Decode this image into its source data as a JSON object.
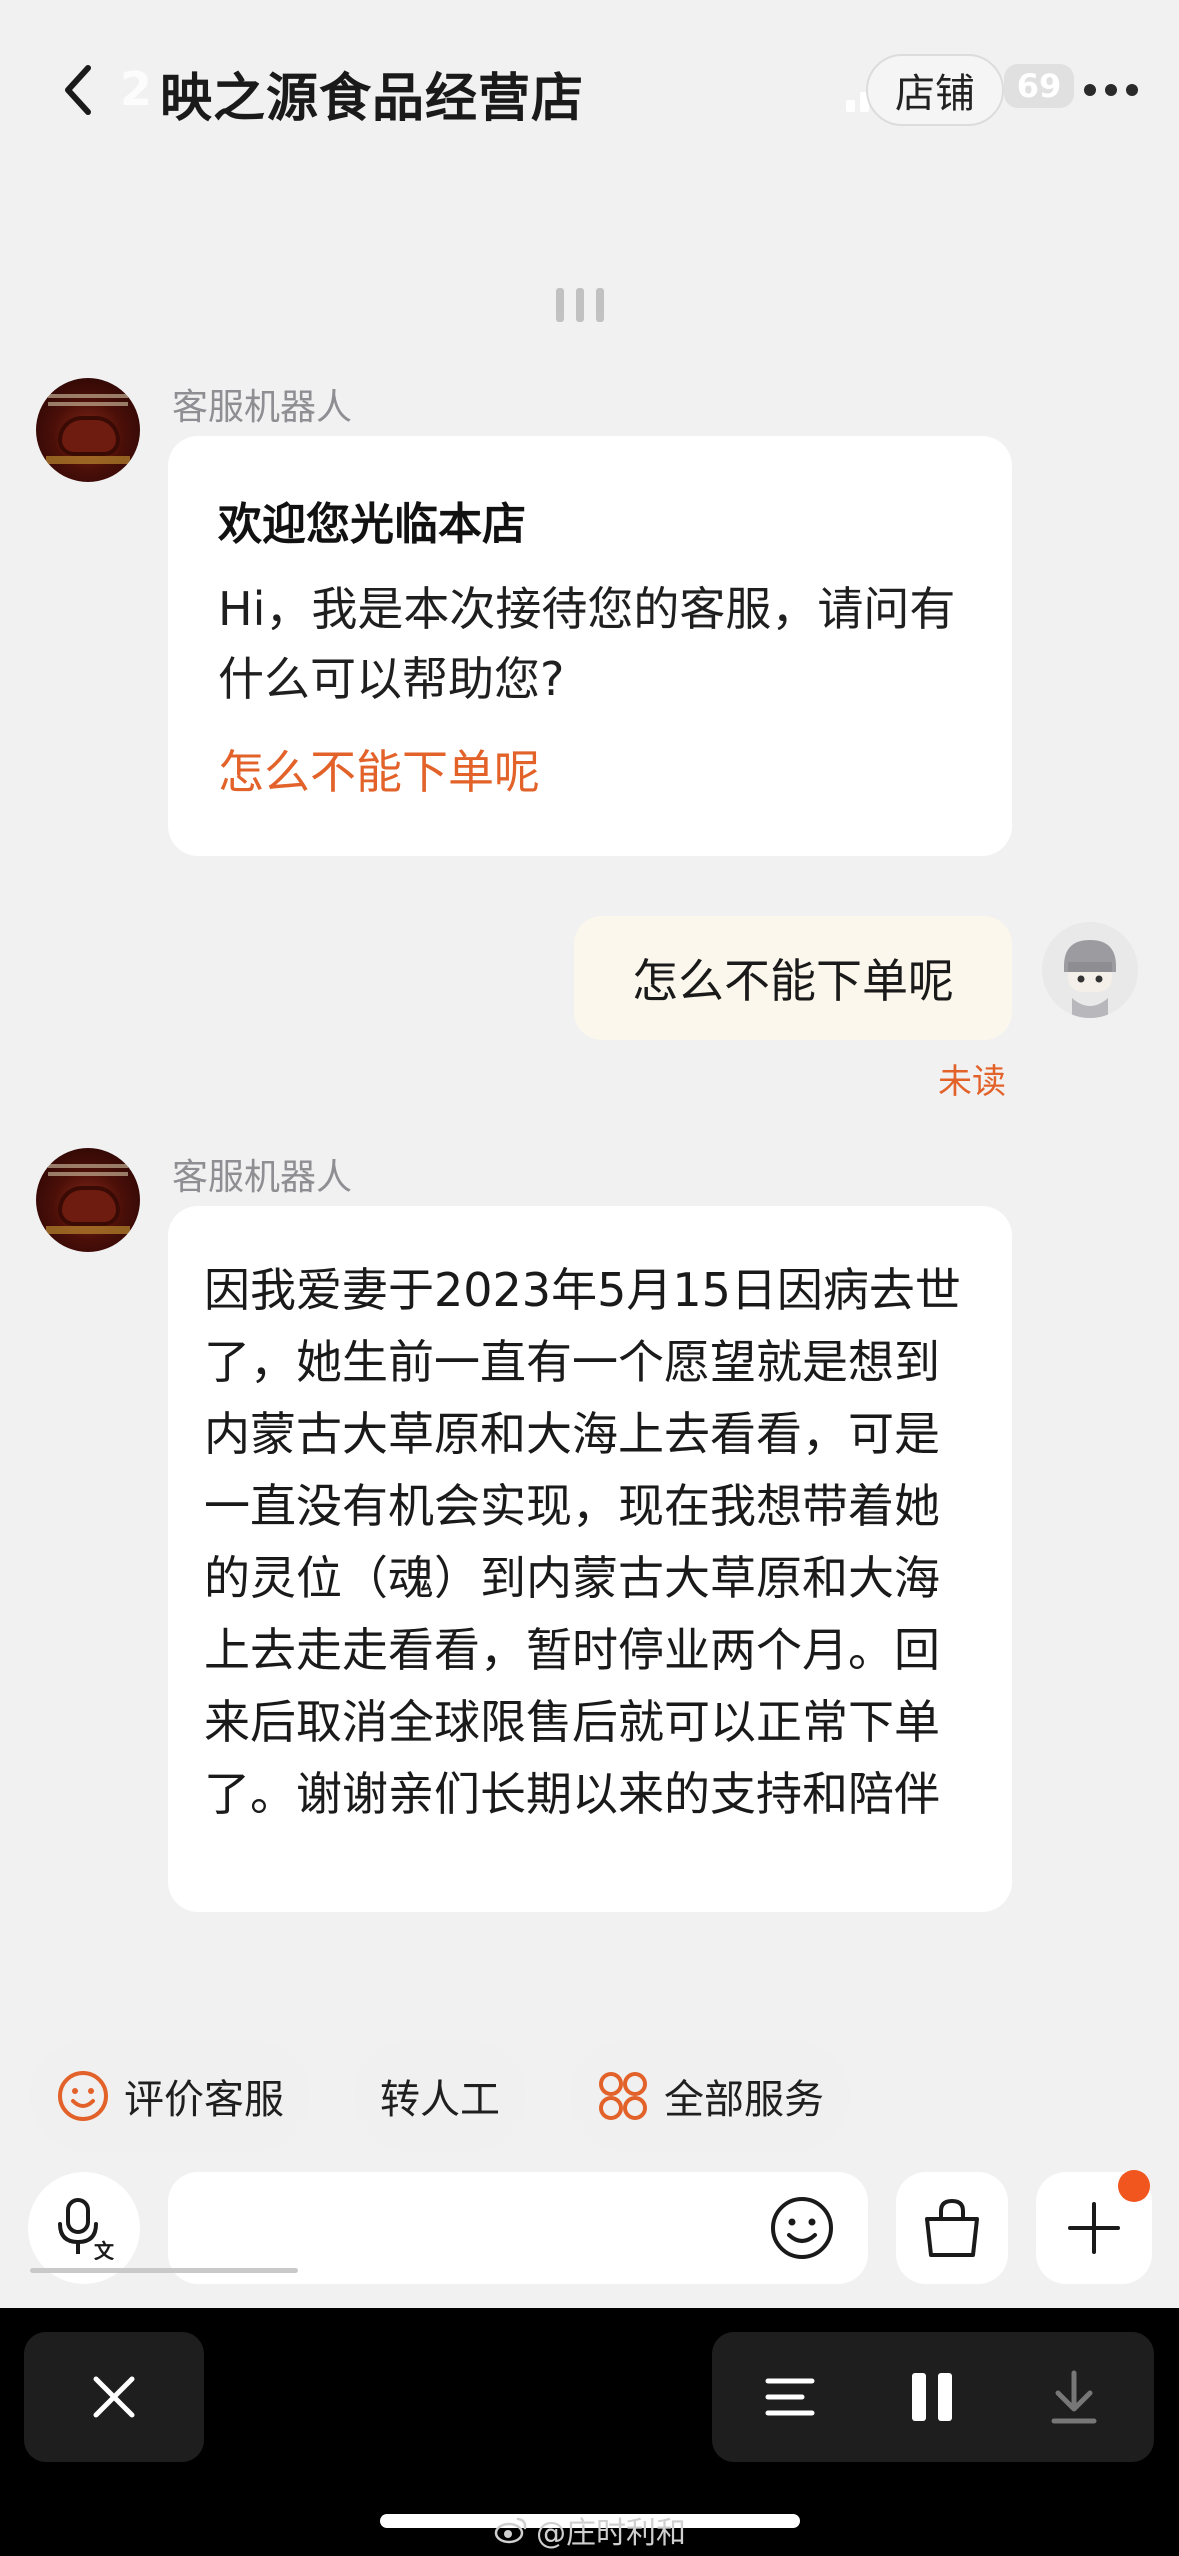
{
  "header": {
    "status_time": "2",
    "shop_title": "映之源食品经营店",
    "store_button": "店铺",
    "battery": "69"
  },
  "messages": [
    {
      "sender": "客服机器人",
      "title": "欢迎您光临本店",
      "body": "Hi，我是本次接待您的客服，请问有什么可以帮助您?",
      "quick_question": "怎么不能下单呢"
    },
    {
      "sender": "me",
      "text": "怎么不能下单呢",
      "status": "未读"
    },
    {
      "sender": "客服机器人",
      "text": "因我爱妻于2023年5月15日因病去世了，她生前一直有一个愿望就是想到内蒙古大草原和大海上去看看，可是一直没有机会实现，现在我想带着她的灵位（魂）到内蒙古大草原和大海上去走走看看，暂时停业两个月。回来后取消全球限售后就可以正常下单了。谢谢亲们长期以来的支持和陪伴"
    }
  ],
  "service_buttons": {
    "rate": "评价客服",
    "transfer": "转人工",
    "all": "全部服务"
  },
  "input": {
    "placeholder": ""
  },
  "watermark": "@庄时利和",
  "colors": {
    "accent": "#e2622a",
    "badge": "#f0561d",
    "background": "#f1f1f2",
    "bubble_right": "#fbf7ec"
  },
  "icons": {
    "back": "chevron-left-icon",
    "more": "more-dots-icon",
    "voice": "microphone-translate-icon",
    "emoji": "smile-icon",
    "bag": "shopping-bag-icon",
    "plus": "plus-icon",
    "rate": "smile-circle-icon",
    "all": "grid-flower-icon",
    "close": "close-icon",
    "menu": "menu-lines-icon",
    "pause": "pause-icon",
    "download": "download-icon"
  }
}
